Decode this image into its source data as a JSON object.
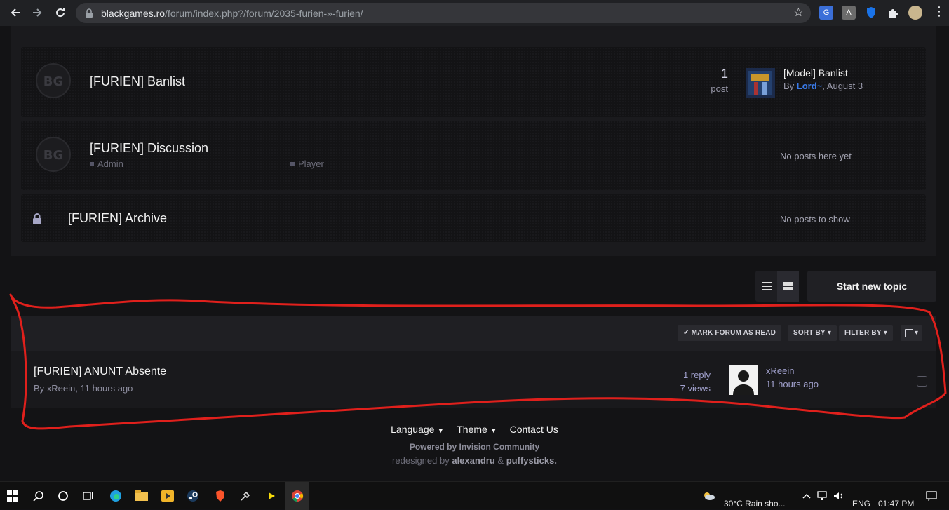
{
  "browser": {
    "url_host": "blackgames.ro",
    "url_path": "/forum/index.php?/forum/2035-furien-»-furien/"
  },
  "forums": [
    {
      "title": "[FURIEN] Banlist",
      "stat_count": "1",
      "stat_label": "post",
      "last_post_title": "[Model] Banlist",
      "last_post_by": "By",
      "last_post_user": "Lord~",
      "last_post_date": ", August 3"
    },
    {
      "title": "[FURIEN] Discussion",
      "subforums": [
        "Admin",
        "Player"
      ],
      "empty_text": "No posts here yet"
    },
    {
      "title": "[FURIEN] Archive",
      "empty_text": "No posts to show"
    }
  ],
  "actions": {
    "start_topic": "Start new topic"
  },
  "topic_bar": {
    "mark_read": "MARK FORUM AS READ",
    "sort_by": "SORT BY",
    "filter_by": "FILTER BY"
  },
  "topics": [
    {
      "title": "[FURIEN] ANUNT Absente",
      "meta": "By xReein, 11 hours ago",
      "replies": "1 reply",
      "views": "7 views",
      "last_user": "xReein",
      "last_time": "11 hours ago"
    }
  ],
  "footer": {
    "language": "Language",
    "theme": "Theme",
    "contact": "Contact Us",
    "powered": "Powered by Invision Community",
    "redesigned_prefix": "redesigned by",
    "author1": "alexandru",
    "amp": "&",
    "author2": "puffysticks."
  },
  "taskbar": {
    "weather": "30°C  Rain sho...",
    "lang": "ENG",
    "time": "01:47 PM"
  },
  "colors": {
    "accent_user": "#3a7bea",
    "annotation": "#e0201c"
  }
}
